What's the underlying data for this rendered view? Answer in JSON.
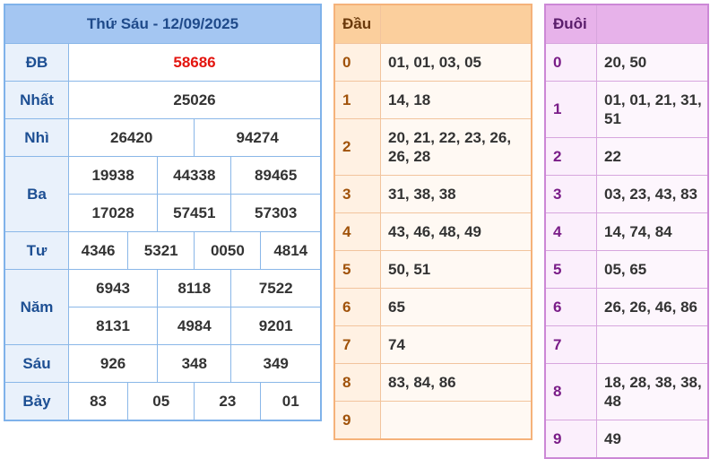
{
  "results": {
    "title": "Thứ Sáu - 12/09/2025",
    "rows": [
      {
        "label": "ĐB",
        "values": [
          "58686"
        ]
      },
      {
        "label": "Nhất",
        "values": [
          "25026"
        ]
      },
      {
        "label": "Nhì",
        "values": [
          "26420",
          "94274"
        ]
      },
      {
        "label": "Ba",
        "values": [
          "19938",
          "44338",
          "89465",
          "17028",
          "57451",
          "57303"
        ]
      },
      {
        "label": "Tư",
        "values": [
          "4346",
          "5321",
          "0050",
          "4814"
        ]
      },
      {
        "label": "Năm",
        "values": [
          "6943",
          "8118",
          "7522",
          "8131",
          "4984",
          "9201"
        ]
      },
      {
        "label": "Sáu",
        "values": [
          "926",
          "348",
          "349"
        ]
      },
      {
        "label": "Bảy",
        "values": [
          "83",
          "05",
          "23",
          "01"
        ]
      }
    ]
  },
  "dau": {
    "header": "Đầu",
    "rows": [
      {
        "key": "0",
        "value": "01, 01, 03, 05"
      },
      {
        "key": "1",
        "value": "14, 18"
      },
      {
        "key": "2",
        "value": "20, 21, 22, 23, 26, 26, 28"
      },
      {
        "key": "3",
        "value": "31, 38, 38"
      },
      {
        "key": "4",
        "value": "43, 46, 48, 49"
      },
      {
        "key": "5",
        "value": "50, 51"
      },
      {
        "key": "6",
        "value": "65"
      },
      {
        "key": "7",
        "value": "74"
      },
      {
        "key": "8",
        "value": "83, 84, 86"
      },
      {
        "key": "9",
        "value": ""
      }
    ]
  },
  "duoi": {
    "header": "Đuôi",
    "rows": [
      {
        "key": "0",
        "value": "20, 50"
      },
      {
        "key": "1",
        "value": "01, 01, 21, 31, 51"
      },
      {
        "key": "2",
        "value": "22"
      },
      {
        "key": "3",
        "value": "03, 23, 43, 83"
      },
      {
        "key": "4",
        "value": "14, 74, 84"
      },
      {
        "key": "5",
        "value": "05, 65"
      },
      {
        "key": "6",
        "value": "26, 26, 46, 86"
      },
      {
        "key": "7",
        "value": ""
      },
      {
        "key": "8",
        "value": "18, 28, 38, 38, 48"
      },
      {
        "key": "9",
        "value": "49"
      }
    ]
  },
  "colors": {
    "special_prize": "#e3150f",
    "results_header": "#a4c6f2",
    "dau_header": "#fbcf9d",
    "duoi_header": "#e7b2ea"
  }
}
